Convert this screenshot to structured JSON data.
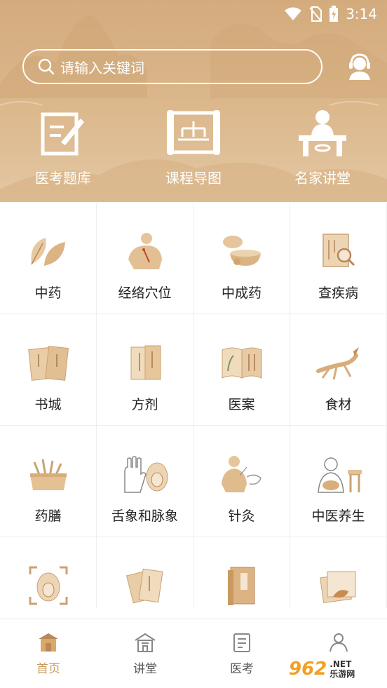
{
  "status_bar": {
    "time": "3:14"
  },
  "search": {
    "placeholder": "请输入关键词"
  },
  "quick_links": [
    {
      "label": "医考题库",
      "icon": "exam-bank-icon"
    },
    {
      "label": "课程导图",
      "icon": "course-map-icon"
    },
    {
      "label": "名家讲堂",
      "icon": "lecture-icon"
    }
  ],
  "grid": [
    {
      "label": "中药",
      "icon": "leaf-icon"
    },
    {
      "label": "经络穴位",
      "icon": "acupoint-icon"
    },
    {
      "label": "中成药",
      "icon": "mortar-icon"
    },
    {
      "label": "查疾病",
      "icon": "disease-search-icon"
    },
    {
      "label": "书城",
      "icon": "books-icon"
    },
    {
      "label": "方剂",
      "icon": "prescription-icon"
    },
    {
      "label": "医案",
      "icon": "case-book-icon"
    },
    {
      "label": "食材",
      "icon": "ginseng-icon"
    },
    {
      "label": "药膳",
      "icon": "medicinal-diet-icon"
    },
    {
      "label": "舌象和脉象",
      "icon": "tongue-pulse-icon"
    },
    {
      "label": "针灸",
      "icon": "acupuncture-icon"
    },
    {
      "label": "中医养生",
      "icon": "health-preservation-icon"
    },
    {
      "label": "",
      "icon": "tongue-scan-icon"
    },
    {
      "label": "",
      "icon": "scrolls-icon"
    },
    {
      "label": "",
      "icon": "classic-book-icon"
    },
    {
      "label": "",
      "icon": "herb-paper-icon"
    }
  ],
  "bottom_nav": [
    {
      "label": "首页",
      "icon": "home-icon",
      "active": true
    },
    {
      "label": "讲堂",
      "icon": "hall-icon",
      "active": false
    },
    {
      "label": "医考",
      "icon": "exam-icon",
      "active": false
    }
  ],
  "watermark": {
    "number": "962",
    "suffix": ".NET",
    "text": "乐游网"
  },
  "colors": {
    "header": "#d9b288",
    "accent": "#c99a5d",
    "icon_tan": "#e4c39a",
    "icon_dark": "#b8875a"
  }
}
